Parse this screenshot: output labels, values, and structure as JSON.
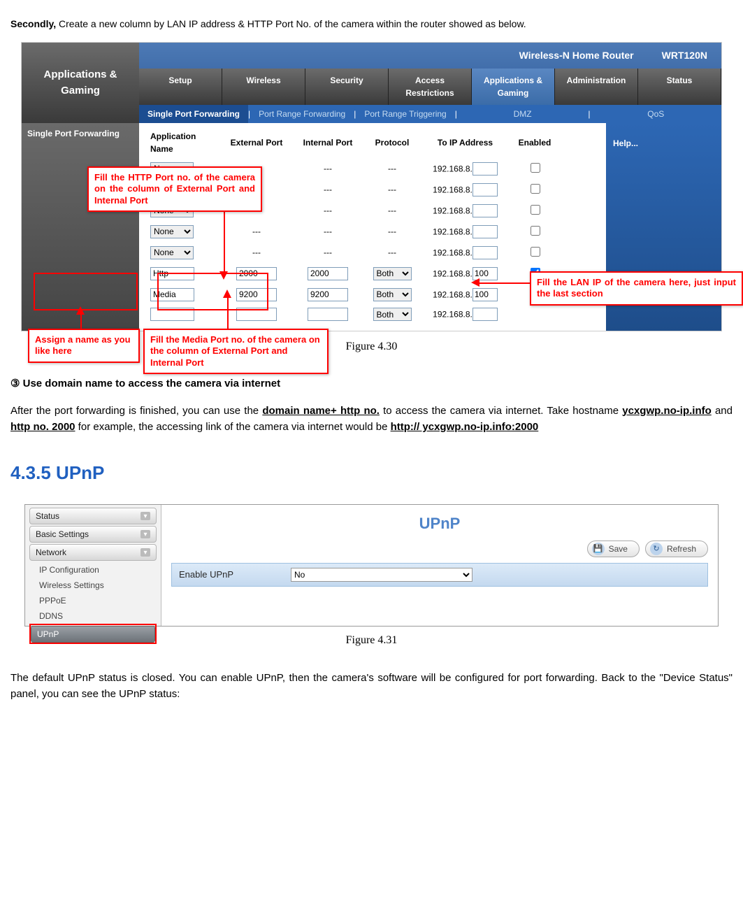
{
  "intro": {
    "lead": "Secondly,",
    "rest": " Create a new column by LAN IP address & HTTP Port No. of the camera within the router showed as below."
  },
  "router": {
    "section_title": "Applications & Gaming",
    "product_name": "Wireless-N Home Router",
    "model": "WRT120N",
    "main_tabs": [
      "Setup",
      "Wireless",
      "Security",
      "Access Restrictions",
      "Applications & Gaming",
      "Administration",
      "Status"
    ],
    "sub_tabs": [
      "Single Port Forwarding",
      "Port Range Forwarding",
      "Port Range Triggering",
      "DMZ",
      "QoS"
    ],
    "left_label": "Single Port Forwarding",
    "tbl": {
      "headers": [
        "Application Name",
        "External Port",
        "Internal Port",
        "Protocol",
        "To IP Address",
        "Enabled"
      ],
      "ip_prefix": "192.168.8.",
      "none": "None",
      "dash": "---",
      "both": "Both",
      "http_row": {
        "name": "Http",
        "ext": "2000",
        "int": "2000",
        "ip": "100"
      },
      "media_row": {
        "name": "Media",
        "ext": "9200",
        "int": "9200",
        "ip": "100"
      }
    },
    "help_label": "Help...",
    "callouts": {
      "name": "Assign a name as you like here",
      "http_port": "Fill the HTTP Port no. of the camera on the column of External Port and Internal Port",
      "media_port": "Fill the Media Port no. of the camera on the column of External Port and Internal Port",
      "lan_ip": "Fill the LAN IP of the camera here, just input the last section"
    }
  },
  "fig1": "Figure 4.30",
  "section3": {
    "title": "③ Use domain name to access the camera via internet",
    "para_a": "After the port forwarding is finished, you can use the ",
    "dn_http": "domain name+ http no.",
    "para_b": " to access the camera via internet. Take hostname ",
    "hostname": "ycxgwp.no-ip.info",
    "para_c": " and ",
    "httpno": "http no. 2000",
    "para_d": " for example, the accessing link of the camera via internet would be ",
    "url": "http:// ycxgwp.no-ip.info:2000"
  },
  "upnp_heading": "4.3.5  UPnP",
  "upnp_panel": {
    "sidebar": {
      "status": "Status",
      "basic": "Basic Settings",
      "network": "Network",
      "subs": [
        "IP Configuration",
        "Wireless Settings",
        "PPPoE",
        "DDNS",
        "UPnP"
      ]
    },
    "title": "UPnP",
    "save": "Save",
    "refresh": "Refresh",
    "enable_label": "Enable UPnP",
    "enable_value": "No"
  },
  "fig2": "Figure 4.31",
  "closing": "The default UPnP status is closed. You can enable UPnP, then the camera's software will be configured for port forwarding. Back to the \"Device Status\" panel, you can see the UPnP status:"
}
